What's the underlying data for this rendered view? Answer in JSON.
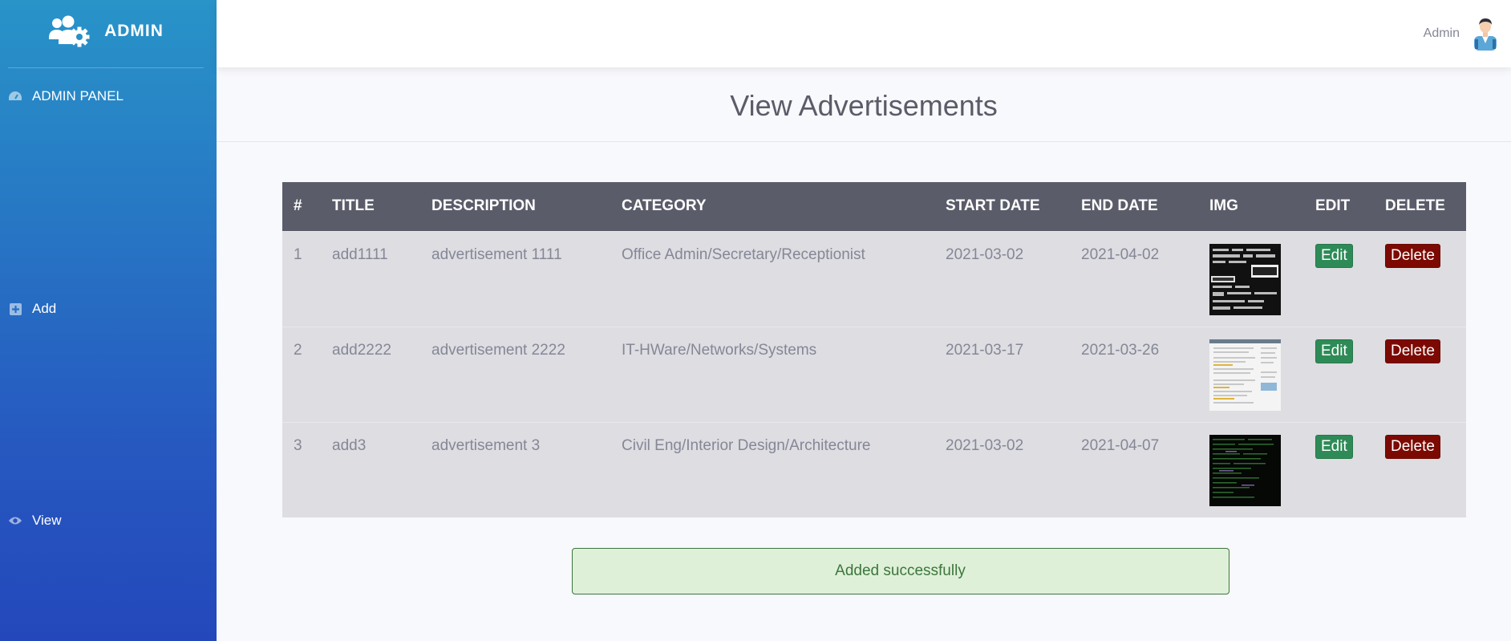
{
  "sidebar": {
    "brand": "ADMIN",
    "items": [
      {
        "label": "ADMIN PANEL",
        "icon": "gauge-icon"
      },
      {
        "label": "Add",
        "icon": "plus-square-icon"
      },
      {
        "label": "View",
        "icon": "eye-icon"
      }
    ]
  },
  "topbar": {
    "user_name": "Admin"
  },
  "page": {
    "title": "View Advertisements"
  },
  "table": {
    "headers": [
      "#",
      "TITLE",
      "DESCRIPTION",
      "CATEGORY",
      "START DATE",
      "END DATE",
      "IMG",
      "EDIT",
      "DELETE"
    ],
    "rows": [
      {
        "num": "1",
        "title": "add1111",
        "description": "advertisement 1111",
        "category": "Office Admin/Secretary/Receptionist",
        "start": "2021-03-02",
        "end": "2021-04-02",
        "edit": "Edit",
        "delete": "Delete"
      },
      {
        "num": "2",
        "title": "add2222",
        "description": "advertisement 2222",
        "category": "IT-HWare/Networks/Systems",
        "start": "2021-03-17",
        "end": "2021-03-26",
        "edit": "Edit",
        "delete": "Delete"
      },
      {
        "num": "3",
        "title": "add3",
        "description": "advertisement 3",
        "category": "Civil Eng/Interior Design/Architecture",
        "start": "2021-03-02",
        "end": "2021-04-07",
        "edit": "Edit",
        "delete": "Delete"
      }
    ]
  },
  "alert": {
    "message": "Added successfully"
  },
  "colors": {
    "edit": "#2e8b57",
    "delete": "#7c0a02",
    "header": "#5a5c69",
    "success_bg": "#dff0d8"
  }
}
